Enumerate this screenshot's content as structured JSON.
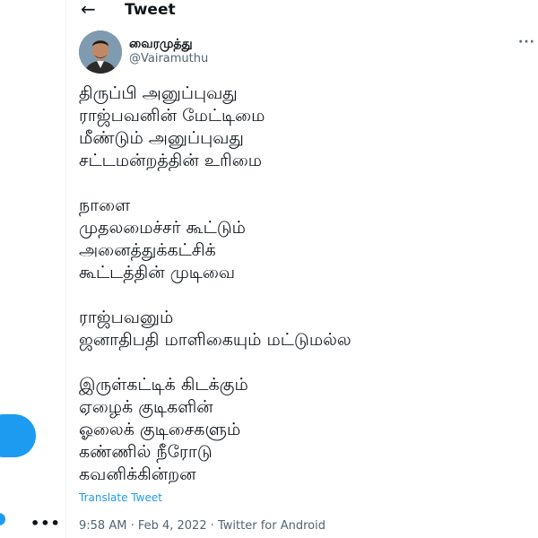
{
  "header": {
    "back_icon": "arrow-left-icon",
    "title": "Tweet"
  },
  "author": {
    "name": "வைரமுத்து",
    "handle": "@Vairamuthu"
  },
  "more_icon": "ellipsis-icon",
  "tweet": {
    "paragraphs": [
      [
        "திருப்பி அனுப்புவது",
        "ராஜ்பவனின் மேட்டிமை",
        "மீண்டும் அனுப்புவது",
        "சட்டமன்றத்தின் உரிமை"
      ],
      [
        "நாளை",
        "முதலமைச்சர் கூட்டும்",
        "அனைத்துக்கட்சிக்",
        "கூட்டத்தின் முடிவை"
      ],
      [
        "ராஜ்பவனும்",
        "ஜனாதிபதி மாளிகையும் மட்டுமல்ல"
      ],
      [
        "இருள்கட்டிக் கிடக்கும்",
        "ஏழைக் குடிகளின்",
        "ஓலைக் குடிசைகளும்",
        "கண்ணில் நீரோடு",
        "கவனிக்கின்றன"
      ]
    ],
    "translate_label": "Translate Tweet",
    "timestamp": "9:58 AM · Feb 4, 2022 · Twitter for Android"
  },
  "sidebar": {
    "account_more": "•••"
  },
  "colors": {
    "accent": "#1d9bf0",
    "text": "#0f1419",
    "secondary": "#536471"
  }
}
